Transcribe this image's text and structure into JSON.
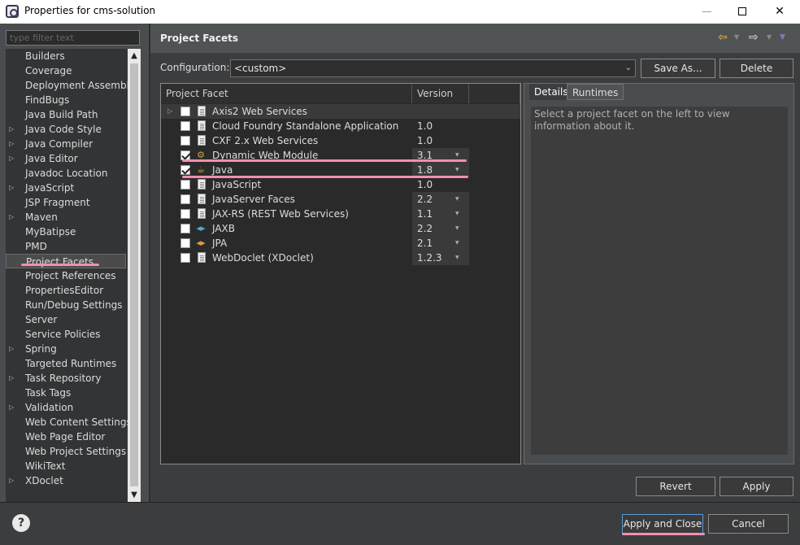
{
  "window": {
    "title": "Properties for cms-solution"
  },
  "sidebar": {
    "filter_placeholder": "type filter text",
    "items": [
      {
        "label": "Builders",
        "expandable": false
      },
      {
        "label": "Coverage",
        "expandable": false
      },
      {
        "label": "Deployment Assembly",
        "expandable": false
      },
      {
        "label": "FindBugs",
        "expandable": false
      },
      {
        "label": "Java Build Path",
        "expandable": false
      },
      {
        "label": "Java Code Style",
        "expandable": true
      },
      {
        "label": "Java Compiler",
        "expandable": true
      },
      {
        "label": "Java Editor",
        "expandable": true
      },
      {
        "label": "Javadoc Location",
        "expandable": false
      },
      {
        "label": "JavaScript",
        "expandable": true
      },
      {
        "label": "JSP Fragment",
        "expandable": false
      },
      {
        "label": "Maven",
        "expandable": true
      },
      {
        "label": "MyBatipse",
        "expandable": false
      },
      {
        "label": "PMD",
        "expandable": false
      },
      {
        "label": "Project Facets",
        "expandable": false,
        "selected": true
      },
      {
        "label": "Project References",
        "expandable": false
      },
      {
        "label": "PropertiesEditor",
        "expandable": false
      },
      {
        "label": "Run/Debug Settings",
        "expandable": false
      },
      {
        "label": "Server",
        "expandable": false
      },
      {
        "label": "Service Policies",
        "expandable": false
      },
      {
        "label": "Spring",
        "expandable": true
      },
      {
        "label": "Targeted Runtimes",
        "expandable": false
      },
      {
        "label": "Task Repository",
        "expandable": true
      },
      {
        "label": "Task Tags",
        "expandable": false
      },
      {
        "label": "Validation",
        "expandable": true
      },
      {
        "label": "Web Content Settings",
        "expandable": false
      },
      {
        "label": "Web Page Editor",
        "expandable": false
      },
      {
        "label": "Web Project Settings",
        "expandable": false
      },
      {
        "label": "WikiText",
        "expandable": false
      },
      {
        "label": "XDoclet",
        "expandable": true
      }
    ]
  },
  "page": {
    "title": "Project Facets",
    "configuration_label": "Configuration:",
    "configuration_value": "<custom>",
    "save_as_label": "Save As...",
    "delete_label": "Delete",
    "revert_label": "Revert",
    "apply_label": "Apply"
  },
  "facets": {
    "col_facet": "Project Facet",
    "col_version": "Version",
    "rows": [
      {
        "name": "Axis2 Web Services",
        "version": "",
        "checked": false,
        "icon": "folder-tree-icon",
        "expandable": true
      },
      {
        "name": "Cloud Foundry Standalone Application",
        "version": "1.0",
        "checked": false,
        "icon": "document-icon"
      },
      {
        "name": "CXF 2.x Web Services",
        "version": "1.0",
        "checked": false,
        "icon": "document-icon"
      },
      {
        "name": "Dynamic Web Module",
        "version": "3.1",
        "checked": true,
        "icon": "web-module-icon",
        "dropdown": true
      },
      {
        "name": "Java",
        "version": "1.8",
        "checked": true,
        "icon": "java-icon",
        "dropdown": true
      },
      {
        "name": "JavaScript",
        "version": "1.0",
        "checked": false,
        "icon": "document-icon"
      },
      {
        "name": "JavaServer Faces",
        "version": "2.2",
        "checked": false,
        "icon": "document-icon",
        "dropdown": true
      },
      {
        "name": "JAX-RS (REST Web Services)",
        "version": "1.1",
        "checked": false,
        "icon": "document-icon",
        "dropdown": true
      },
      {
        "name": "JAXB",
        "version": "2.2",
        "checked": false,
        "icon": "jaxb-icon",
        "dropdown": true
      },
      {
        "name": "JPA",
        "version": "2.1",
        "checked": false,
        "icon": "jpa-icon",
        "dropdown": true
      },
      {
        "name": "WebDoclet (XDoclet)",
        "version": "1.2.3",
        "checked": false,
        "icon": "document-icon",
        "dropdown": true
      }
    ]
  },
  "details": {
    "tab_details": "Details",
    "tab_runtimes": "Runtimes",
    "body_text": "Select a project facet on the left to view information about it."
  },
  "footer": {
    "apply_close_label": "Apply and Close",
    "cancel_label": "Cancel"
  },
  "colors": {
    "annotation": "#f08fb0",
    "back_arrow": "#e8b84a"
  }
}
